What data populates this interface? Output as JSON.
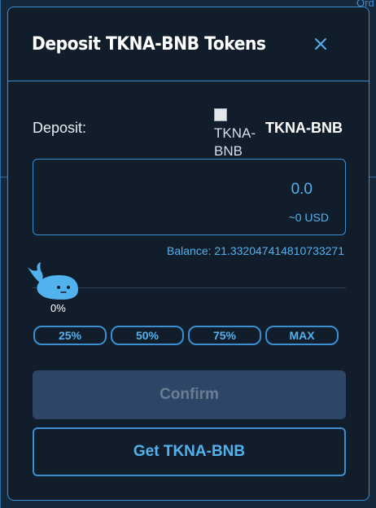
{
  "background": {
    "top_right_text": "Ord"
  },
  "modal": {
    "title": "Deposit TKNA-BNB Tokens",
    "deposit_label": "Deposit:",
    "token": {
      "image_alt": "TKNA-BNB",
      "name": "TKNA-BNB"
    },
    "amount": {
      "value": "0.0",
      "usd": "~0 USD"
    },
    "balance": "Balance: 21.332047414810733271",
    "slider": {
      "percent_label": "0%",
      "value": 0
    },
    "percent_buttons": [
      "25%",
      "50%",
      "75%",
      "MAX"
    ],
    "confirm_label": "Confirm",
    "get_token_label": "Get TKNA-BNB"
  },
  "colors": {
    "accent": "#3a8fd0",
    "accent_text": "#52b2ee",
    "modal_bg": "#121d2b",
    "confirm_disabled_bg": "#2d4566"
  }
}
